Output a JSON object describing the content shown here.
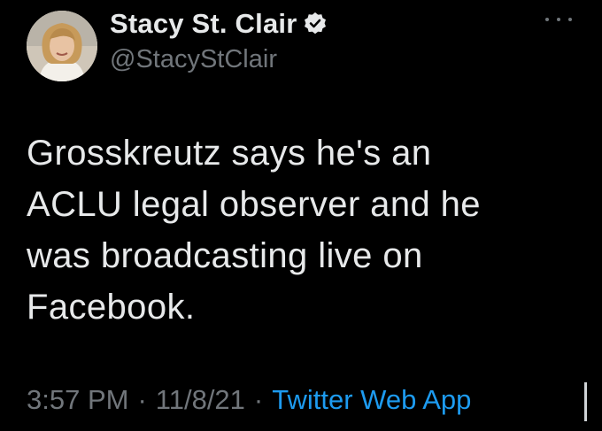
{
  "author": {
    "display_name": "Stacy St. Clair",
    "handle": "@StacyStClair",
    "verified": true
  },
  "tweet": {
    "lines": [
      "Grosskreutz says he's an",
      "ACLU legal observer and he",
      "was broadcasting live on",
      "Facebook."
    ]
  },
  "meta": {
    "time": "3:57 PM",
    "separator": "·",
    "date": "11/8/21",
    "source": "Twitter Web App"
  },
  "colors": {
    "background": "#000000",
    "text": "#e7e9ea",
    "secondary": "#71767b",
    "link": "#1d9bf0"
  },
  "icons": {
    "verified": "verified-badge-icon",
    "more": "more-options-icon"
  }
}
